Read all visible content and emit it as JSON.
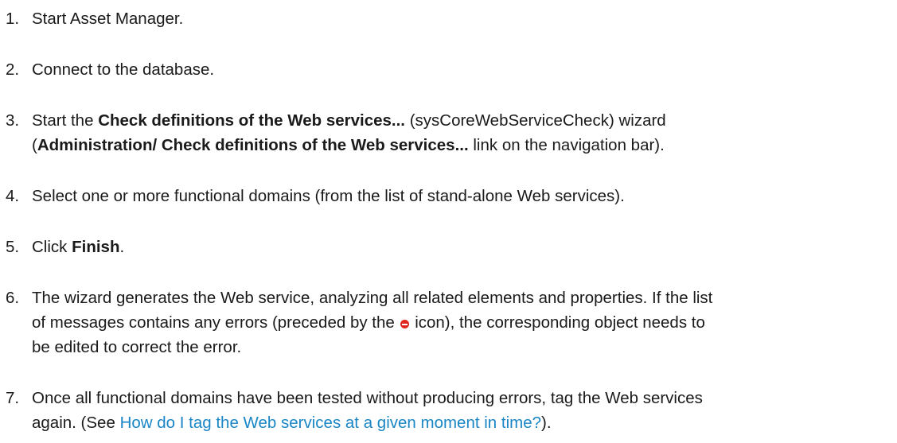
{
  "steps": [
    {
      "num": "1.",
      "text": "Start Asset Manager."
    },
    {
      "num": "2.",
      "text": "Connect to the database."
    },
    {
      "num": "3.",
      "t1": "Start the ",
      "b1": "Check definitions of the Web services...",
      "t2": " (sysCoreWebServiceCheck) wizard",
      "t3": "(",
      "b2": "Administration/ Check definitions of the Web services...",
      "t4": " link on the navigation bar)."
    },
    {
      "num": "4.",
      "text": "Select one or more functional domains (from the list of stand-alone Web services)."
    },
    {
      "num": "5.",
      "t1": "Click ",
      "b1": "Finish",
      "t2": "."
    },
    {
      "num": "6.",
      "l1": "The wizard generates the Web service, analyzing all related elements and properties. If the list",
      "l2a": "of messages contains any errors (preceded by the ",
      "l2b": " icon), the corresponding object needs to",
      "l3": "be edited to correct the error.",
      "icon": "error-icon"
    },
    {
      "num": "7.",
      "l1": "Once all functional domains have been tested without producing errors, tag the Web services",
      "l2a": "again. (See ",
      "link": "How do I tag the Web services at a given moment in time?",
      "l2b": ")."
    }
  ],
  "colors": {
    "text": "#1a1a1a",
    "link": "#1a86c6",
    "error_icon": "#e0261d"
  }
}
